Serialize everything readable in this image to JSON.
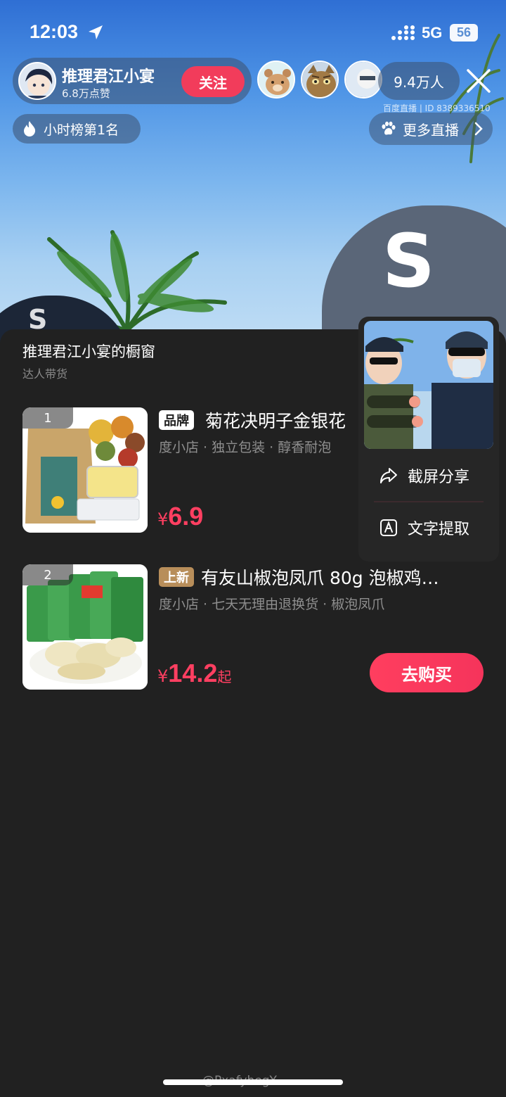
{
  "status_bar": {
    "time": "12:03",
    "network": "5G",
    "battery": "56"
  },
  "host": {
    "name": "推理君江小宴",
    "likes": "6.8万点赞",
    "follow_label": "关注"
  },
  "viewers": {
    "count": "9.4万人"
  },
  "background": {
    "watermark": "百度直播 | ID 8389336510",
    "cap_letter_left": "S",
    "cap_letter_right": "S"
  },
  "rank_badge": {
    "label": "小时榜第1名"
  },
  "more_live": {
    "label": "更多直播"
  },
  "shop": {
    "title": "推理君江小宴的橱窗",
    "subtitle": "达人带货",
    "products": [
      {
        "index": "1",
        "tag": "品牌",
        "title": "菊花决明子金银花",
        "desc": "度小店 · 独立包装 · 醇香耐泡",
        "currency": "¥",
        "price": "6.9",
        "price_suffix": ""
      },
      {
        "index": "2",
        "tag": "上新",
        "title": "有友山椒泡凤爪 80g 泡椒鸡…",
        "desc": "度小店 · 七天无理由退换货 · 椒泡凤爪",
        "currency": "¥",
        "price": "14.2",
        "price_suffix": "起",
        "buy_label": "去购买"
      }
    ]
  },
  "context_menu": {
    "items": [
      {
        "label": "截屏分享",
        "icon": "share-icon"
      },
      {
        "label": "文字提取",
        "icon": "text-extract-icon"
      }
    ]
  },
  "footer": {
    "watermark": "@PxafyhegY"
  },
  "colors": {
    "accent": "#f23c5b",
    "price": "#ff3f61",
    "panel": "#212121",
    "new_tag": "#b88e5a"
  }
}
